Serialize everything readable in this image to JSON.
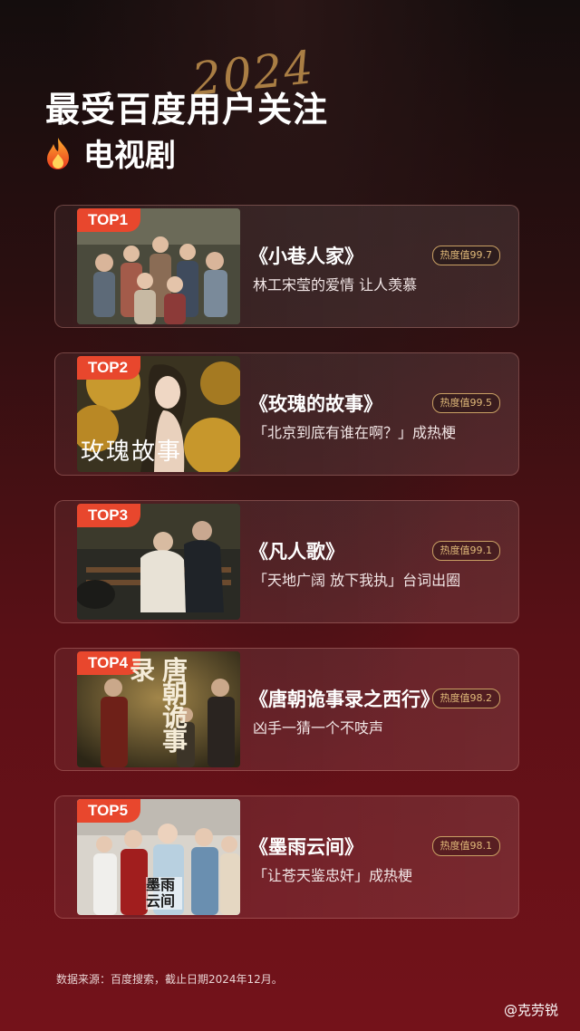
{
  "header": {
    "year": "2024",
    "title": "最受百度用户关注",
    "subtitle": "电视剧",
    "icons": {
      "subtitle": "fire-icon"
    }
  },
  "cards": [
    {
      "rank": "TOP1",
      "title": "《小巷人家》",
      "heat": "热度值99.7",
      "desc": "林工宋莹的爱情 让人羡慕",
      "poster_caption": ""
    },
    {
      "rank": "TOP2",
      "title": "《玫瑰的故事》",
      "heat": "热度值99.5",
      "desc": "「北京到底有谁在啊？」成热梗",
      "poster_caption": "玫瑰故事"
    },
    {
      "rank": "TOP3",
      "title": "《凡人歌》",
      "heat": "热度值99.1",
      "desc": "「天地广阔 放下我执」台词出圈",
      "poster_caption": ""
    },
    {
      "rank": "TOP4",
      "title": "《唐朝诡事录之西行》",
      "heat": "热度值98.2",
      "desc": "凶手一猜一个不吱声",
      "poster_caption": "唐朝诡事录"
    },
    {
      "rank": "TOP5",
      "title": "《墨雨云间》",
      "heat": "热度值98.1",
      "desc": "「让苍天鉴忠奸」成热梗",
      "poster_caption": "墨雨云间"
    }
  ],
  "footer": {
    "source": "数据来源：百度搜索，截止日期2024年12月。",
    "watermark": "@克劳锐"
  },
  "colors": {
    "rank_badge": "#e8472d",
    "heat_badge": "#c9a064",
    "background_bottom": "#74121a"
  }
}
